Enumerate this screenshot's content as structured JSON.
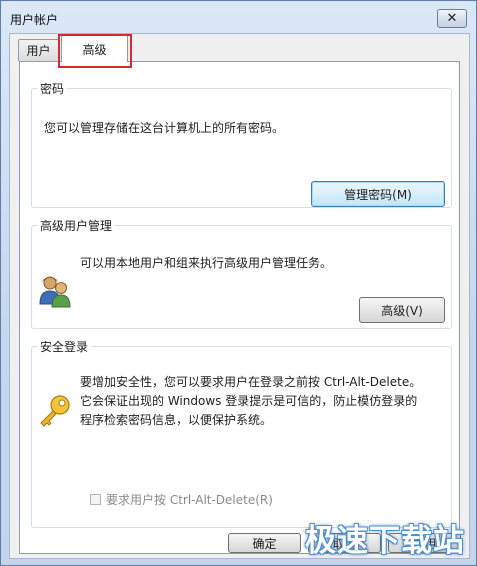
{
  "window": {
    "title": "用户帐户",
    "close_glyph": "✕"
  },
  "tabs": [
    {
      "label": "用户",
      "selected": false
    },
    {
      "label": "高级",
      "selected": true
    }
  ],
  "passwords": {
    "legend": "密码",
    "description": "您可以管理存储在这台计算机上的所有密码。",
    "button": "管理密码(M)"
  },
  "advanced_users": {
    "legend": "高级用户管理",
    "icon": "users-icon",
    "description": "可以用本地用户和组来执行高级用户管理任务。",
    "button": "高级(V)"
  },
  "secure_logon": {
    "legend": "安全登录",
    "icon": "key-icon",
    "lines": [
      "要增加安全性，您可以要求用户在登录之前按 Ctrl-Alt-Delete。",
      "它会保证出现的 Windows 登录提示是可信的，防止模仿登录的",
      "程序检索密码信息，以便保护系统。"
    ],
    "checkbox_label": "要求用户按 Ctrl-Alt-Delete(R)",
    "checkbox_checked": false,
    "checkbox_enabled": false
  },
  "footer": {
    "ok": "确定",
    "cancel": "取消",
    "apply": "应用"
  },
  "watermark": "极速下载站",
  "colors": {
    "highlight": "#d9282f",
    "watermark_outline": "#4d8fd0"
  }
}
